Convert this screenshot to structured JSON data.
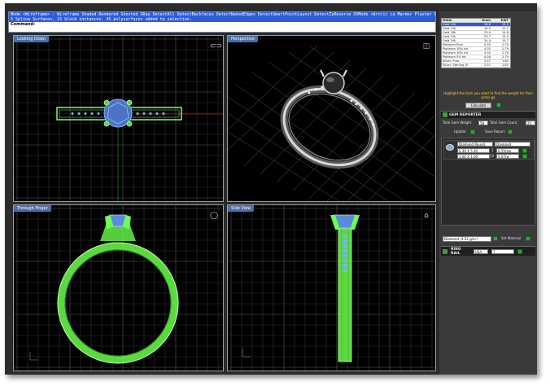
{
  "command": {
    "history": [
      "Mode <Wireframe> : Wireframe  Shaded  Rendered  Ghosted  XRay  DetectAll  DetectBackfaces  DetectNakedEdges  DetectSmartPointLayout  DetectZyReverse  OVMode  <Arctic  ca  Marmor  Plaster  Presentation",
      "5 Spline Surfaces, 21 block instances, 45 polysurfaces added to selection."
    ],
    "prompt_label": "Command:"
  },
  "viewports": {
    "top_left": {
      "title": "Looking Down"
    },
    "top_right": {
      "title": "Perspective"
    },
    "bottom_left": {
      "title": "Through Finger"
    },
    "bottom_right": {
      "title": "Side View"
    }
  },
  "panel": {
    "weight_table": {
      "headers": [
        "Metal",
        "Gram",
        "DWT"
      ],
      "rows": [
        [
          "Gold 10k",
          "18.6",
          "12.0"
        ],
        [
          "Gold 14k",
          "18.9",
          "12.2"
        ],
        [
          "Gold 18k",
          "23.0",
          "14.8"
        ],
        [
          "Gold 22k",
          "23.7",
          "15.3"
        ],
        [
          "Gold 24k",
          "24.4",
          "15.7"
        ],
        [
          "Platinum Pure",
          "4.35",
          "2.79"
        ],
        [
          "Platinum 10% Ird",
          "4.35",
          "2.79"
        ],
        [
          "Platinum 10% Ird",
          "4.35",
          "2.79"
        ],
        [
          "Platinum 5% Ird",
          "4.34",
          "2.79"
        ],
        [
          "Silver, Pure",
          "2.57",
          "1.65"
        ],
        [
          "Silver, Sterling (0",
          "2.51",
          "1.62"
        ]
      ]
    },
    "highlight_text": "Highlight the item you want to find the weight for then press go",
    "calculate_label": "Calculate",
    "gem_reporter": {
      "title": "GEM REPORTER",
      "total_gem_weight_label": "Total Gem Weight",
      "total_gem_weight_value": "58",
      "total_gem_count_label": "Total Gem Count",
      "total_gem_count_value": "25",
      "update_label": "Update",
      "save_report_label": "Save Report",
      "gems": [
        {
          "shape": "Diamond Round",
          "type": "Diamond",
          "size": "5.30 X 5.30",
          "qty": "1",
          "weight": "0.55ctw"
        },
        {
          "shape": "",
          "type": "",
          "size": "1.00 X 1.00",
          "qty": "10",
          "weight": "0.07tw"
        }
      ],
      "material_select": "Diamond  (3.52 g/cc)",
      "set_material_label": "Set Material"
    },
    "ring_rail": {
      "title": "RING RAIL",
      "region": "USA",
      "size": "7"
    }
  }
}
